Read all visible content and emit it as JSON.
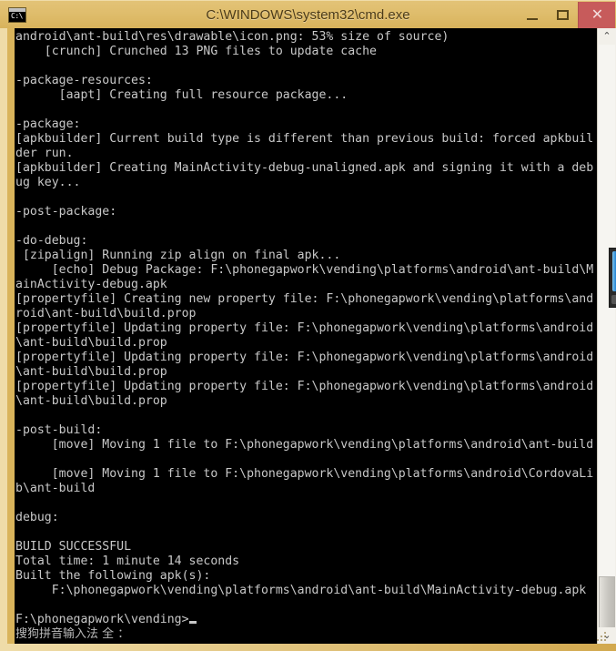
{
  "window": {
    "title": "C:\\WINDOWS\\system32\\cmd.exe",
    "icon_label": "C:\\",
    "icon_name": "cmd-console-icon",
    "titlebar_color": "#dfbd6c",
    "frame_color": "#d9b45b",
    "close_button_color": "#c75b5b",
    "controls": {
      "minimize_label": "–",
      "maximize_label": "□",
      "close_label": "✕"
    }
  },
  "console": {
    "background_color": "#000000",
    "text_color": "#c8c8c8",
    "cursor": "_",
    "lines": [
      "android\\ant-build\\res\\drawable\\icon.png: 53% size of source)",
      "    [crunch] Crunched 13 PNG files to update cache",
      "",
      "-package-resources:",
      "      [aapt] Creating full resource package...",
      "",
      "-package:",
      "[apkbuilder] Current build type is different than previous build: forced apkbuil",
      "der run.",
      "[apkbuilder] Creating MainActivity-debug-unaligned.apk and signing it with a deb",
      "ug key...",
      "",
      "-post-package:",
      "",
      "-do-debug:",
      " [zipalign] Running zip align on final apk...",
      "     [echo] Debug Package: F:\\phonegapwork\\vending\\platforms\\android\\ant-build\\M",
      "ainActivity-debug.apk",
      "[propertyfile] Creating new property file: F:\\phonegapwork\\vending\\platforms\\and",
      "roid\\ant-build\\build.prop",
      "[propertyfile] Updating property file: F:\\phonegapwork\\vending\\platforms\\android",
      "\\ant-build\\build.prop",
      "[propertyfile] Updating property file: F:\\phonegapwork\\vending\\platforms\\android",
      "\\ant-build\\build.prop",
      "[propertyfile] Updating property file: F:\\phonegapwork\\vending\\platforms\\android",
      "\\ant-build\\build.prop",
      "",
      "-post-build:",
      "     [move] Moving 1 file to F:\\phonegapwork\\vending\\platforms\\android\\ant-build",
      "",
      "     [move] Moving 1 file to F:\\phonegapwork\\vending\\platforms\\android\\CordovaLi",
      "b\\ant-build",
      "",
      "debug:",
      "",
      "BUILD SUCCESSFUL",
      "Total time: 1 minute 14 seconds",
      "Built the following apk(s):",
      "     F:\\phonegapwork\\vending\\platforms\\android\\ant-build\\MainActivity-debug.apk",
      ""
    ],
    "prompt": "F:\\phonegapwork\\vending>"
  },
  "ime": {
    "status_text": "搜狗拼音输入法 全 ："
  },
  "scrollbar": {
    "up_arrow": "⌃",
    "down_arrow": "⌄"
  }
}
